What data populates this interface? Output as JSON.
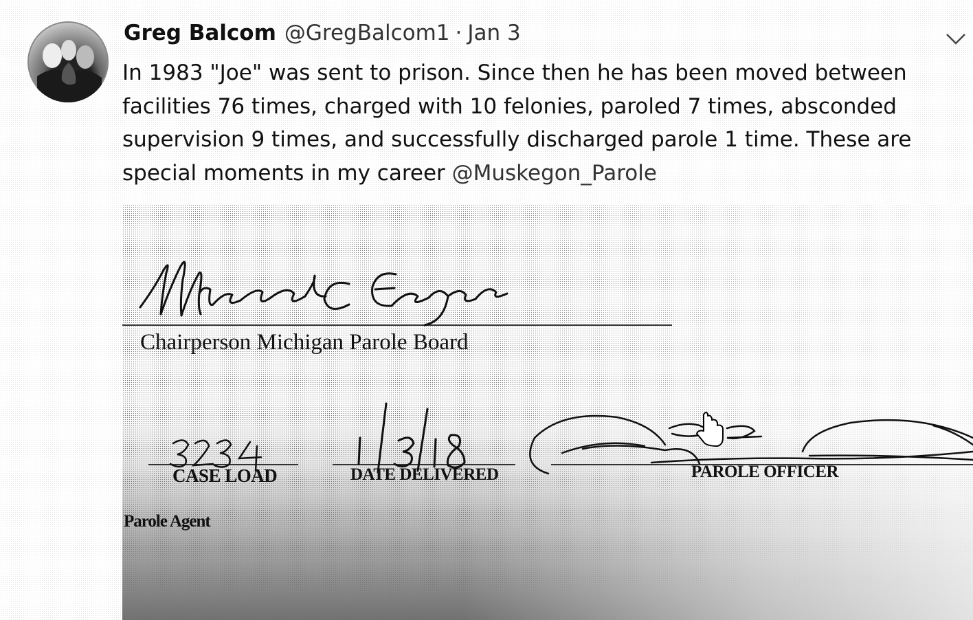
{
  "tweet": {
    "author_name": "Greg Balcom",
    "handle": "@GregBalcom1",
    "separator": "·",
    "date": "Jan 3",
    "text": "In 1983 \"Joe\" was sent to prison. Since then he has been moved between facilities 76 times, charged with 10 felonies, paroled 7 times, absconded supervision 9 times, and successfully discharged parole 1 time. These are special moments in my career",
    "mention": "@Muskegon_Parole"
  },
  "icons": {
    "menu": "chevron-down-icon",
    "cursor": "hand-pointer-icon"
  },
  "document": {
    "chair_caption": "Chairperson Michigan Parole Board",
    "chair_signature": "Michael C Eagen",
    "case_load_label": "CASE LOAD",
    "case_load_value": "3234",
    "date_label": "DATE DELIVERED",
    "date_value": "1/3/18",
    "officer_label": "PAROLE OFFICER",
    "agent_label": "Parole Agent"
  }
}
